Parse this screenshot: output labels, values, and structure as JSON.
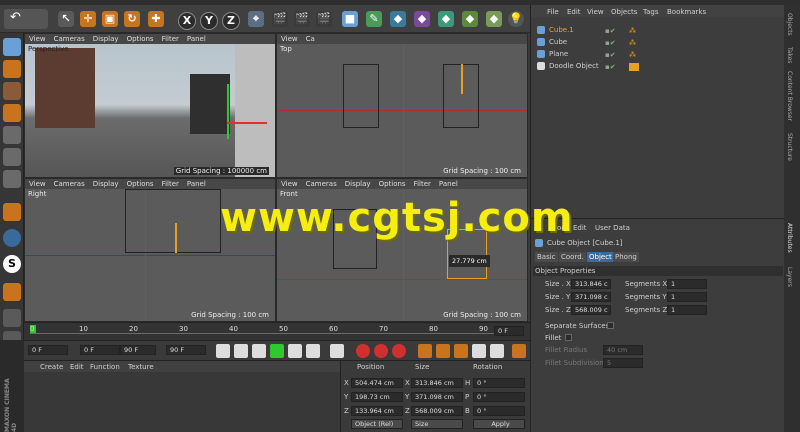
{
  "toolbar": {
    "axes": [
      "X",
      "Y",
      "Z"
    ]
  },
  "viewports": {
    "menu": [
      "View",
      "Cameras",
      "Display",
      "Options",
      "Filter",
      "Panel"
    ],
    "perspective": {
      "label": "Perspective",
      "grid": "Grid Spacing : 100000 cm"
    },
    "top": {
      "label": "Top",
      "grid": "Grid Spacing : 100 cm",
      "menu": [
        "View",
        "Ca"
      ]
    },
    "right": {
      "label": "Right",
      "grid": "Grid Spacing : 100 cm"
    },
    "front": {
      "label": "Front",
      "grid": "Grid Spacing : 100 cm",
      "measure": "27.779 cm"
    }
  },
  "timeline": {
    "ticks": [
      "0",
      "10",
      "20",
      "30",
      "40",
      "50",
      "60",
      "70",
      "80",
      "90"
    ],
    "frame_end": "0 F"
  },
  "transport": {
    "start": "0 F",
    "field2": "0 F",
    "field3": "90 F",
    "end": "90 F"
  },
  "materials": {
    "menu": [
      "Create",
      "Edit",
      "Function",
      "Texture"
    ]
  },
  "coords": {
    "headers": [
      "Position",
      "Size",
      "Rotation"
    ],
    "rows": [
      {
        "axis": "X",
        "pos": "504.474 cm",
        "size_axis": "X",
        "size": "313.846 cm",
        "rot_axis": "H",
        "rot": "0 °"
      },
      {
        "axis": "Y",
        "pos": "198.73 cm",
        "size_axis": "Y",
        "size": "371.098 cm",
        "rot_axis": "P",
        "rot": "0 °"
      },
      {
        "axis": "Z",
        "pos": "133.964 cm",
        "size_axis": "Z",
        "size": "568.009 cm",
        "rot_axis": "B",
        "rot": "0 °"
      }
    ],
    "mode": "Object (Rel)",
    "size_mode": "Size",
    "apply": "Apply"
  },
  "object_manager": {
    "menu": [
      "File",
      "Edit",
      "View",
      "Objects",
      "Tags",
      "Bookmarks"
    ],
    "objects": [
      "Cube.1",
      "Cube",
      "Plane",
      "Doodle Object"
    ]
  },
  "attributes": {
    "menu": [
      "Mode",
      "Edit",
      "User Data"
    ],
    "title": "Cube Object [Cube.1]",
    "tabs": [
      "Basic",
      "Coord.",
      "Object",
      "Phong"
    ],
    "section": "Object Properties",
    "size_x_label": "Size . X",
    "size_x": "313.846 c",
    "size_y_label": "Size . Y",
    "size_y": "371.098 c",
    "size_z_label": "Size . Z",
    "size_z": "568.009 c",
    "seg_x_label": "Segments X",
    "seg_x": "1",
    "seg_y_label": "Segments Y",
    "seg_y": "1",
    "seg_z_label": "Segments Z",
    "seg_z": "1",
    "separate": "Separate Surfaces",
    "fillet": "Fillet",
    "fillet_radius": "Fillet Radius",
    "fillet_radius_val": "40 cm",
    "fillet_sub": "Fillet Subdivision",
    "fillet_sub_val": "5"
  },
  "side_tabs": [
    "Objects",
    "Takes",
    "Content Browser",
    "Structure",
    "Attributes",
    "Layers"
  ],
  "brand": "MAXON CINEMA 4D",
  "watermark": "www.cgtsj.com"
}
